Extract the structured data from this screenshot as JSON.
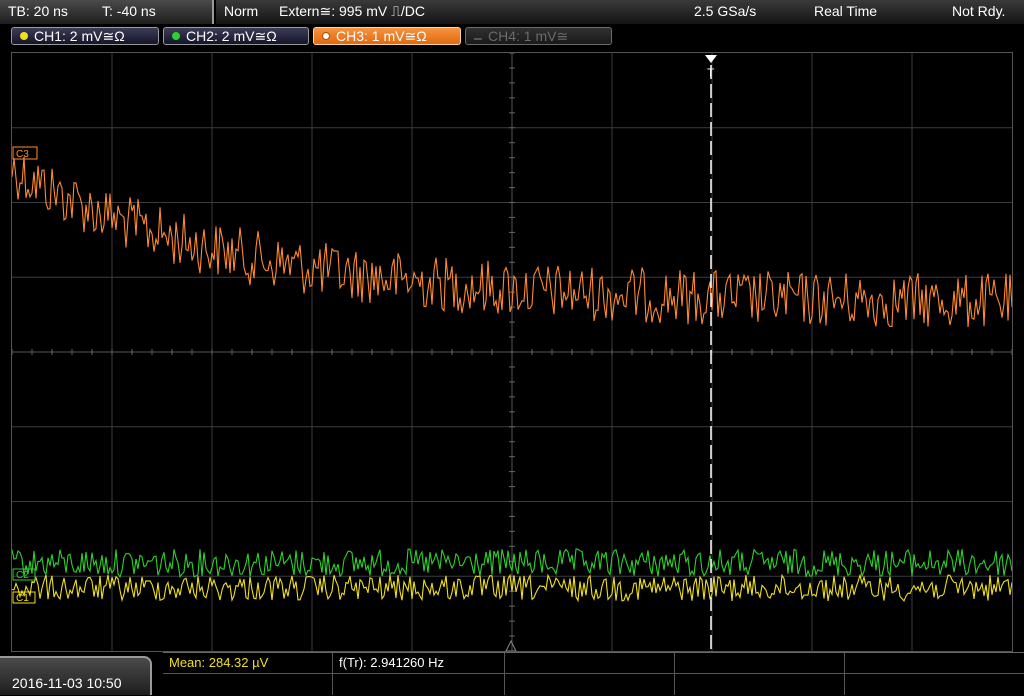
{
  "header": {
    "timebase": "TB: 20 ns",
    "trigger_offset": "T: -40 ns",
    "trigger_mode": "Norm",
    "trigger_source": "Extern≅: 995 mV ⎍/DC",
    "sample_rate": "2.5 GSa/s",
    "acq_mode": "Real Time",
    "status": "Not Rdy."
  },
  "channels": [
    {
      "label": "CH1: 2 mV≅Ω",
      "color": "#f0e01e"
    },
    {
      "label": "CH2: 2 mV≅Ω",
      "color": "#2ed02e"
    },
    {
      "label": "CH3: 1 mV≅Ω",
      "color": "#ff8a30"
    },
    {
      "label": "CH4: 1 mV≅",
      "color": "#777777"
    }
  ],
  "markers": {
    "ch1_marker": "C1",
    "ch2_marker": "C2",
    "ch3_marker": "C3",
    "trigger_marker": "T"
  },
  "footer": {
    "datetime": "2016-11-03 10:50",
    "measurements": [
      {
        "label": "Mean: 284.32 µV",
        "color": "#f0e01e"
      },
      {
        "label": "f(Tr): 2.941260 Hz",
        "color": "#ffffff"
      }
    ]
  },
  "colors": {
    "ch1": "#f0e01e",
    "ch2": "#2ed02e",
    "ch3": "#ff8a30",
    "grid": "#3c3c3c",
    "trigger_line": "#ffffff"
  }
}
